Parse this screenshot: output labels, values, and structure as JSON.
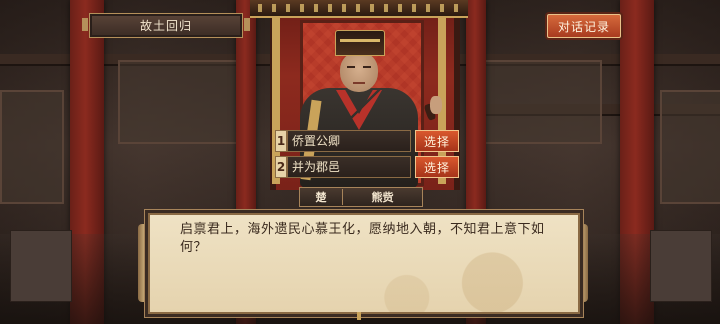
{
  "header": {
    "title": "故土回归",
    "log_button": "对话记录"
  },
  "choices": [
    {
      "number": "1",
      "text": "侨置公卿",
      "button": "选择"
    },
    {
      "number": "2",
      "text": "并为郡邑",
      "button": "选择"
    }
  ],
  "speaker": {
    "faction": "楚",
    "name": "熊赀"
  },
  "dialog": {
    "text": "启禀君上，海外遗民心慕王化，愿纳地入朝，不知君上意下如何？"
  },
  "colors": {
    "accent": "#c9a35a",
    "button_red": "#b83b1f",
    "parchment": "#ebdcbb"
  }
}
